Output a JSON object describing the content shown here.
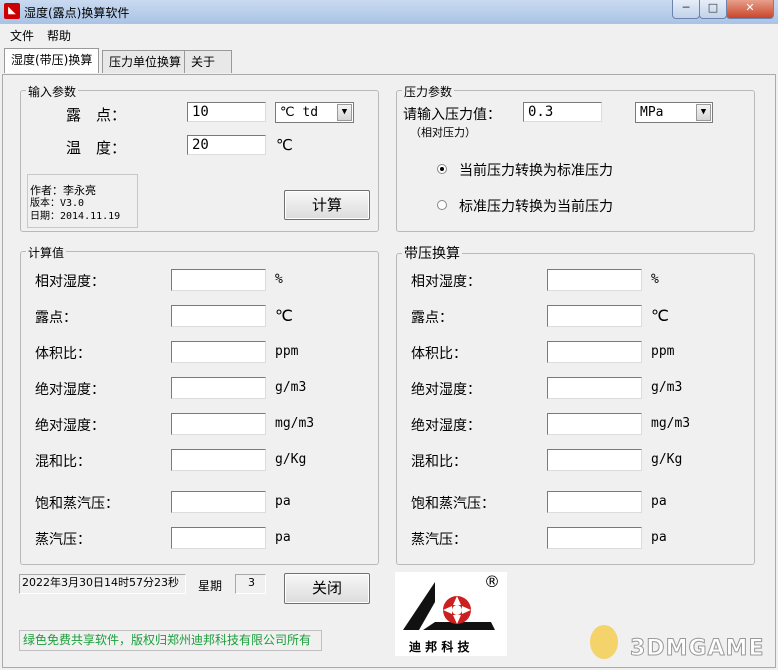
{
  "window": {
    "title": "湿度(露点)换算软件",
    "icon": "app-logo-icon",
    "min": "─",
    "max": "□",
    "close": "✕"
  },
  "menu": {
    "file": "文件",
    "help": "帮助"
  },
  "tabs": [
    "湿度(带压)换算",
    "压力单位换算",
    "关于"
  ],
  "input_params": {
    "title": "输入参数",
    "dew_label": "露　点：",
    "dew_value": "10",
    "dew_unit": "℃ td",
    "temp_label": "温　度：",
    "temp_value": "20",
    "temp_unit": "℃",
    "author": "作者：李永亮",
    "version": "版本：V3.0",
    "date": "日期：2014.11.19",
    "calc": "计算"
  },
  "pressure_params": {
    "title": "压力参数",
    "prompt": "请输入压力值：",
    "value": "0.3",
    "unit": "MPa",
    "note": "（相对压力）",
    "option1": "当前压力转换为标准压力",
    "option2": "标准压力转换为当前压力",
    "selected": 1
  },
  "calc_values": {
    "title": "计算值",
    "rows": [
      {
        "label": "相对湿度：",
        "unit": "%"
      },
      {
        "label": "露点：",
        "unit": "℃"
      },
      {
        "label": "体积比：",
        "unit": "ppm"
      },
      {
        "label": "绝对湿度：",
        "unit": "g/m3"
      },
      {
        "label": "绝对湿度：",
        "unit": "mg/m3"
      },
      {
        "label": "混和比：",
        "unit": "g/Kg"
      },
      {
        "label": "饱和蒸汽压：",
        "unit": "pa"
      },
      {
        "label": "蒸汽压：",
        "unit": "pa"
      }
    ]
  },
  "pressure_calc": {
    "title": "带压换算",
    "rows": [
      {
        "label": "相对湿度：",
        "unit": "%"
      },
      {
        "label": "露点：",
        "unit": "℃"
      },
      {
        "label": "体积比：",
        "unit": "ppm"
      },
      {
        "label": "绝对湿度：",
        "unit": "g/m3"
      },
      {
        "label": "绝对湿度：",
        "unit": "mg/m3"
      },
      {
        "label": "混和比：",
        "unit": "g/Kg"
      },
      {
        "label": "饱和蒸汽压：",
        "unit": "pa"
      },
      {
        "label": "蒸汽压：",
        "unit": "pa"
      }
    ]
  },
  "status": {
    "datetime": "2022年3月30日14时57分23秒",
    "weekday_label": "星期",
    "weekday_value": "3",
    "close": "关闭"
  },
  "footer": "绿色免费共享软件，版权归郑州迪邦科技有限公司所有",
  "brand": {
    "name": "迪 邦 科 技",
    "registered": "®"
  },
  "watermark": "3DMGAME",
  "colors": {
    "footer_text": "#1a9e3a",
    "brand_red": "#cc1f1f"
  }
}
